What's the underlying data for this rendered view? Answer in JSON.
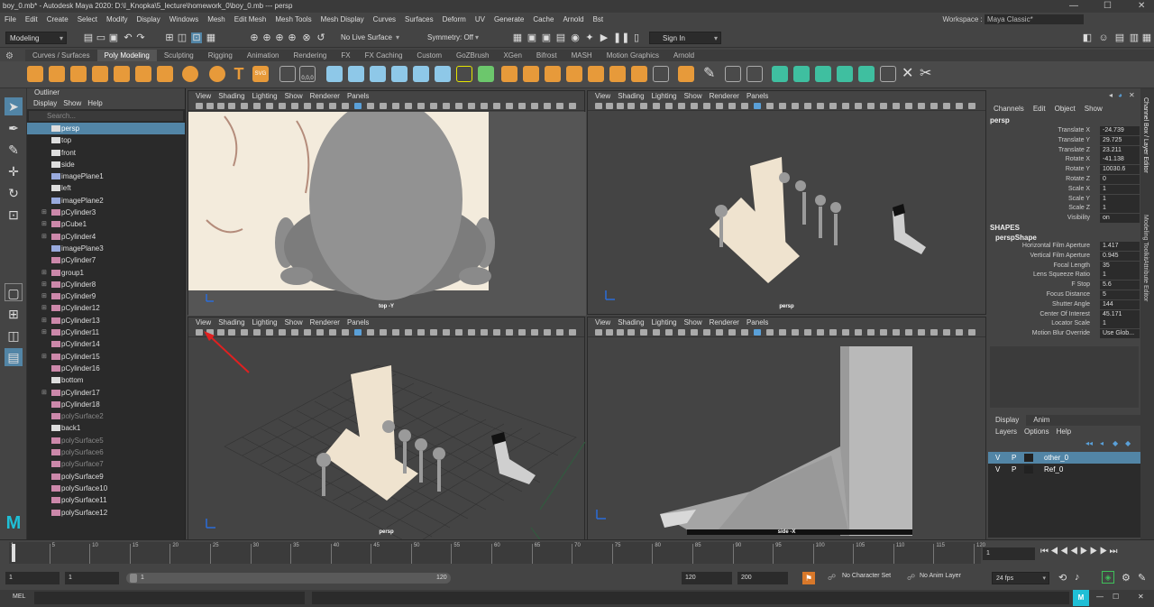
{
  "title": {
    "text": "boy_0.mb* - Autodesk Maya 2020: D:\\I_Knopka\\5_lecture\\homework_0\\boy_0.mb  ---  persp",
    "min": "—",
    "max": "☐",
    "close": "✕"
  },
  "menus": [
    "File",
    "Edit",
    "Create",
    "Select",
    "Modify",
    "Display",
    "Windows",
    "Mesh",
    "Edit Mesh",
    "Mesh Tools",
    "Mesh Display",
    "Curves",
    "Surfaces",
    "Deform",
    "UV",
    "Generate",
    "Cache",
    "Arnold",
    "Bst"
  ],
  "workspace": {
    "label": "Workspace :",
    "value": "Maya Classic*"
  },
  "status": {
    "mode": "Modeling",
    "live": "No Live Surface",
    "symmetry": "Symmetry: Off",
    "signin": "Sign In"
  },
  "shelf_tabs": [
    "Curves / Surfaces",
    "Poly Modeling",
    "Sculpting",
    "Rigging",
    "Animation",
    "Rendering",
    "FX",
    "FX Caching",
    "Custom",
    "GoZBrush",
    "XGen",
    "Bifrost",
    "MASH",
    "Motion Graphics",
    "Arnold"
  ],
  "shelf_active": "Poly Modeling",
  "shelf_text": {
    "text_tool": "T",
    "svg_tool": "SVG",
    "nums": "0,0,0"
  },
  "outliner": {
    "title": "Outliner",
    "menu": [
      "Display",
      "Show",
      "Help"
    ],
    "search": "Search...",
    "items": [
      {
        "label": "persp",
        "type": "cam",
        "sel": true
      },
      {
        "label": "top",
        "type": "cam"
      },
      {
        "label": "front",
        "type": "cam"
      },
      {
        "label": "side",
        "type": "cam"
      },
      {
        "label": "imagePlane1",
        "type": "img"
      },
      {
        "label": "left",
        "type": "cam"
      },
      {
        "label": "imagePlane2",
        "type": "img"
      },
      {
        "label": "pCylinder3",
        "type": "mesh",
        "ex": true
      },
      {
        "label": "pCube1",
        "type": "mesh",
        "ex": true
      },
      {
        "label": "pCylinder4",
        "type": "mesh",
        "ex": true
      },
      {
        "label": "imagePlane3",
        "type": "img"
      },
      {
        "label": "pCylinder7",
        "type": "mesh"
      },
      {
        "label": "group1",
        "type": "mesh",
        "ex": true
      },
      {
        "label": "pCylinder8",
        "type": "mesh",
        "ex": true
      },
      {
        "label": "pCylinder9",
        "type": "mesh",
        "ex": true
      },
      {
        "label": "pCylinder12",
        "type": "mesh",
        "ex": true
      },
      {
        "label": "pCylinder13",
        "type": "mesh",
        "ex": true
      },
      {
        "label": "pCylinder11",
        "type": "mesh",
        "ex": true
      },
      {
        "label": "pCylinder14",
        "type": "mesh"
      },
      {
        "label": "pCylinder15",
        "type": "mesh",
        "ex": true
      },
      {
        "label": "pCylinder16",
        "type": "mesh"
      },
      {
        "label": "bottom",
        "type": "cam"
      },
      {
        "label": "pCylinder17",
        "type": "mesh",
        "ex": true
      },
      {
        "label": "pCylinder18",
        "type": "mesh"
      },
      {
        "label": "polySurface2",
        "type": "mesh",
        "dim": true
      },
      {
        "label": "back1",
        "type": "cam"
      },
      {
        "label": "polySurface5",
        "type": "mesh",
        "dim": true
      },
      {
        "label": "polySurface6",
        "type": "mesh",
        "dim": true
      },
      {
        "label": "polySurface7",
        "type": "mesh",
        "dim": true
      },
      {
        "label": "polySurface9",
        "type": "mesh"
      },
      {
        "label": "polySurface10",
        "type": "mesh"
      },
      {
        "label": "polySurface11",
        "type": "mesh"
      },
      {
        "label": "polySurface12",
        "type": "mesh"
      }
    ]
  },
  "viewport": {
    "menu": [
      "View",
      "Shading",
      "Lighting",
      "Show",
      "Renderer",
      "Panels"
    ],
    "panels": [
      {
        "name": "top-viewport",
        "camera": "top -Y"
      },
      {
        "name": "persp-viewport-top-right",
        "camera": "persp"
      },
      {
        "name": "persp-viewport-bottom-left",
        "camera": "persp"
      },
      {
        "name": "side-viewport",
        "camera": "side -X"
      }
    ]
  },
  "channel_box": {
    "menu": [
      "Channels",
      "Edit",
      "Object",
      "Show"
    ],
    "object": "persp",
    "attrs": [
      {
        "n": "Translate X",
        "v": "-24.739"
      },
      {
        "n": "Translate Y",
        "v": "29.725"
      },
      {
        "n": "Translate Z",
        "v": "23.211"
      },
      {
        "n": "Rotate X",
        "v": "-41.138"
      },
      {
        "n": "Rotate Y",
        "v": "10030.6"
      },
      {
        "n": "Rotate Z",
        "v": "0"
      },
      {
        "n": "Scale X",
        "v": "1"
      },
      {
        "n": "Scale Y",
        "v": "1"
      },
      {
        "n": "Scale Z",
        "v": "1"
      },
      {
        "n": "Visibility",
        "v": "on"
      }
    ],
    "shapes_label": "SHAPES",
    "shape": "perspShape",
    "shape_attrs": [
      {
        "n": "Horizontal Film Aperture",
        "v": "1.417"
      },
      {
        "n": "Vertical Film Aperture",
        "v": "0.945"
      },
      {
        "n": "Focal Length",
        "v": "35"
      },
      {
        "n": "Lens Squeeze Ratio",
        "v": "1"
      },
      {
        "n": "F Stop",
        "v": "5.6"
      },
      {
        "n": "Focus Distance",
        "v": "5"
      },
      {
        "n": "Shutter Angle",
        "v": "144"
      },
      {
        "n": "Center Of Interest",
        "v": "45.171"
      },
      {
        "n": "Locator Scale",
        "v": "1"
      },
      {
        "n": "Motion Blur Override",
        "v": "Use Glob..."
      }
    ]
  },
  "side_tabs": [
    "Channel Box / Layer Editor",
    "Modeling Toolkit",
    "Attribute Editor"
  ],
  "layers": {
    "tabs": [
      "Display",
      "Anim"
    ],
    "menu": [
      "Layers",
      "Options",
      "Help"
    ],
    "items": [
      {
        "v": "V",
        "p": "P",
        "name": "other_0",
        "sel": true
      },
      {
        "v": "V",
        "p": "P",
        "name": "Ref_0"
      }
    ]
  },
  "timeline": {
    "ticks": [
      "5",
      "10",
      "15",
      "20",
      "25",
      "30",
      "35",
      "40",
      "45",
      "50",
      "55",
      "60",
      "65",
      "70",
      "75",
      "80",
      "85",
      "90",
      "95",
      "100",
      "105",
      "110",
      "115",
      "120"
    ],
    "start_mark": "1",
    "current": "1"
  },
  "range": {
    "start": "1",
    "inner_start": "1",
    "slider_start": "1",
    "slider_end": "120",
    "end": "120",
    "max": "200",
    "character_set": "No Character Set",
    "anim_layer": "No Anim Layer",
    "fps": "24 fps"
  },
  "cmdline": {
    "label": "MEL"
  },
  "colors": {
    "accent": "#5285a6",
    "annotation": "#e02020",
    "dark": "#2b2b2b"
  }
}
